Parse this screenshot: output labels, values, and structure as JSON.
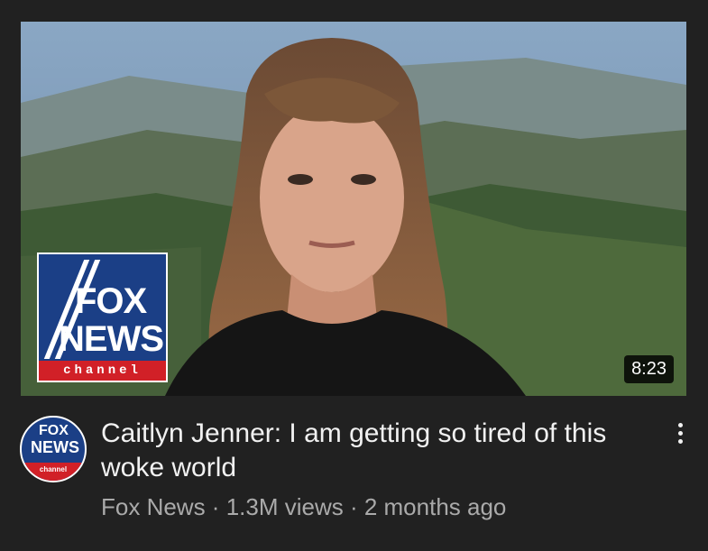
{
  "video": {
    "duration": "8:23",
    "title": "Caitlyn Jenner: I am getting so tired of this woke world",
    "channel": "Fox News",
    "views": "1.3M views",
    "age": "2 months ago",
    "separator": " · "
  },
  "thumbnail_logo": {
    "line1": "FOX",
    "line2": "NEWS",
    "line3": "channel"
  },
  "avatar_logo": {
    "line1": "FOX",
    "line2": "NEWS",
    "line3": "channel"
  },
  "icons": {
    "more": "more-vertical-icon"
  },
  "colors": {
    "background": "#212121",
    "title": "#f1f1f1",
    "meta": "#aaaaaa",
    "fox_blue": "#1b3f86",
    "fox_red": "#d12027"
  }
}
